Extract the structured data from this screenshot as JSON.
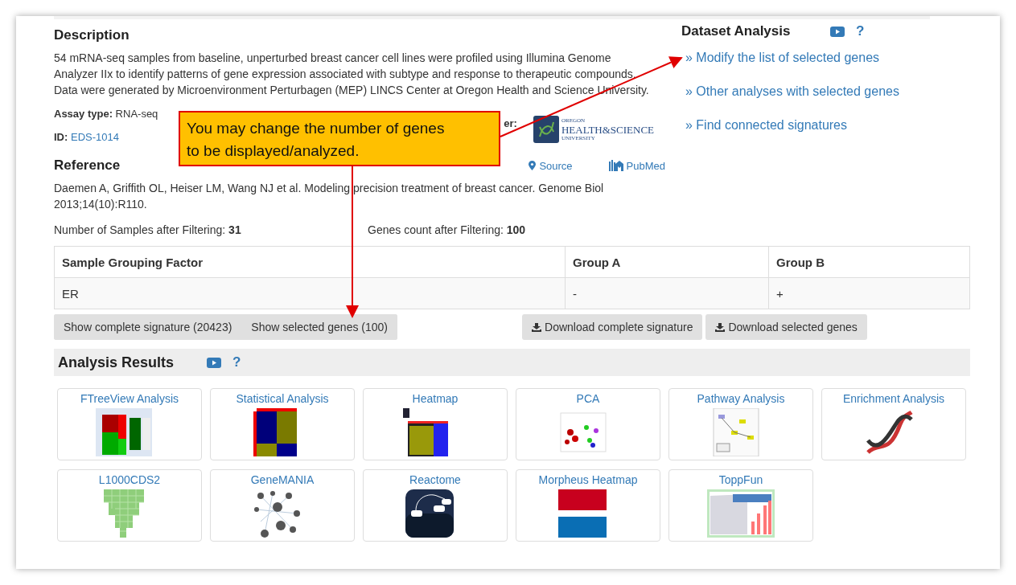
{
  "description": {
    "title": "Description",
    "text": "54 mRNA-seq samples from baseline, unperturbed breast cancer cell lines were profiled using Illumina Genome Analyzer IIx to identify patterns of gene expression associated with subtype and response to therapeutic compounds. Data were generated by Microenvironment Perturbagen (MEP) LINCS Center at Oregon Health and Science University.",
    "assay_label": "Assay type:",
    "assay_value": "RNA-seq",
    "id_label": "ID:",
    "id_value": "EDS-1014",
    "provider_label": "er:",
    "provider_logo": [
      "OREGON",
      "HEALTH&SCIENCE",
      "UNIVERSITY"
    ]
  },
  "dataset_analysis": {
    "title": "Dataset Analysis",
    "help": "?",
    "links": [
      "» Modify the list of selected genes",
      "» Other analyses with selected genes",
      "» Find connected signatures"
    ]
  },
  "reference": {
    "title": "Reference",
    "source": "Source",
    "pubmed": "PubMed",
    "citation": "Daemen A, Griffith OL, Heiser LM, Wang NJ et al. Modeling precision treatment of breast cancer. Genome Biol 2013;14(10):R110."
  },
  "filtering": {
    "samples_label": "Number of Samples after Filtering:",
    "samples_value": "31",
    "genes_label": "Genes count after Filtering:",
    "genes_value": "100"
  },
  "grouping_table": {
    "columns": [
      "Sample Grouping Factor",
      "Group A",
      "Group B"
    ],
    "rows": [
      [
        "ER",
        "-",
        "+"
      ]
    ]
  },
  "signature_buttons": [
    "Show complete signature (20423)",
    "Show selected genes (100)"
  ],
  "download_buttons": [
    "Download complete signature",
    "Download selected genes"
  ],
  "analysis_results": {
    "title": "Analysis Results",
    "help": "?",
    "tiles": [
      {
        "label": "FTreeView Analysis",
        "kind": "ftree"
      },
      {
        "label": "Statistical Analysis",
        "kind": "stat"
      },
      {
        "label": "Heatmap",
        "kind": "heatmap"
      },
      {
        "label": "PCA",
        "kind": "pca"
      },
      {
        "label": "Pathway Analysis",
        "kind": "pathway"
      },
      {
        "label": "Enrichment Analysis",
        "kind": "dna"
      },
      {
        "label": "L1000CDS2",
        "kind": "funnel"
      },
      {
        "label": "GeneMANIA",
        "kind": "network"
      },
      {
        "label": "Reactome",
        "kind": "reactome"
      },
      {
        "label": "Morpheus Heatmap",
        "kind": "morpheus"
      },
      {
        "label": "ToppFun",
        "kind": "toppfun"
      }
    ]
  },
  "callout": {
    "text": "You may change the number of genes to be displayed/analyzed."
  }
}
